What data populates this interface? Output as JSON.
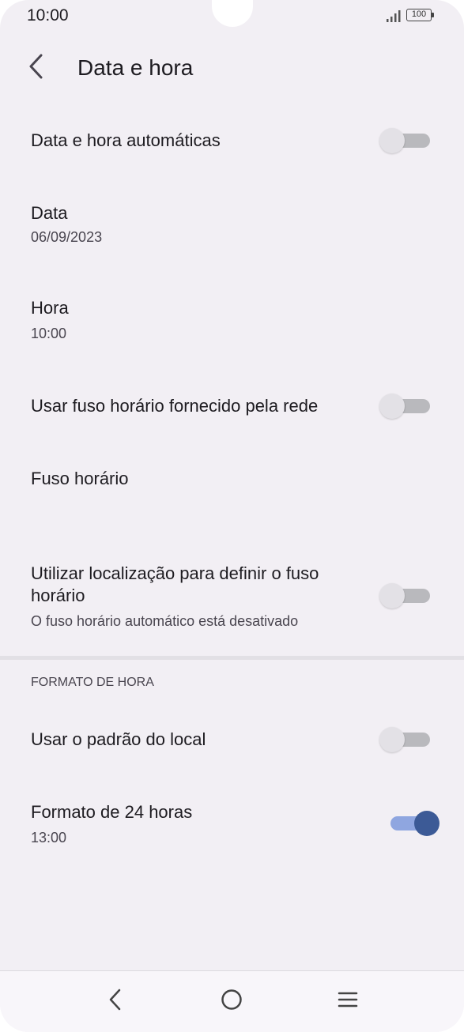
{
  "status_bar": {
    "time": "10:00",
    "battery": "100"
  },
  "app_bar": {
    "title": "Data e hora"
  },
  "settings": {
    "auto_datetime": {
      "title": "Data e hora automáticas",
      "enabled": false
    },
    "date": {
      "title": "Data",
      "value": "06/09/2023"
    },
    "time": {
      "title": "Hora",
      "value": "10:00"
    },
    "network_timezone": {
      "title": "Usar fuso horário fornecido pela rede",
      "enabled": false
    },
    "timezone": {
      "title": "Fuso horário"
    },
    "location_timezone": {
      "title": "Utilizar localização para definir o fuso horário",
      "subtitle": "O fuso horário automático está desativado",
      "enabled": false
    }
  },
  "time_format_section": {
    "header": "FORMATO DE HORA",
    "locale_default": {
      "title": "Usar o padrão do local",
      "enabled": false
    },
    "format_24h": {
      "title": "Formato de 24 horas",
      "example": "13:00",
      "enabled": true
    }
  },
  "colors": {
    "background": "#f2eff4",
    "toggle_on_thumb": "#3c5a96",
    "toggle_on_track": "#8fa6e0",
    "toggle_off_thumb": "#e3e1e6",
    "toggle_off_track": "#b9b9bd"
  },
  "icons": {
    "back": "chevron-left-icon",
    "signal": "signal-icon",
    "battery": "battery-icon",
    "nav_back": "nav-back-icon",
    "nav_home": "nav-home-icon",
    "nav_recents": "nav-menu-icon"
  }
}
